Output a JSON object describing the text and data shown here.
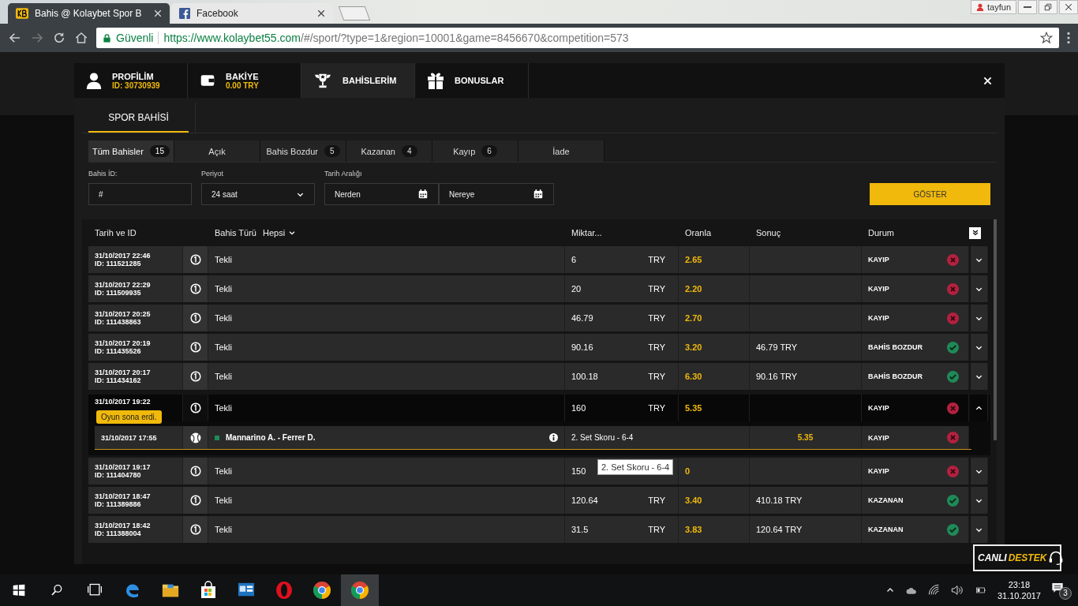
{
  "browser": {
    "tabs": [
      {
        "title": "Bahis @ Kolaybet Spor B",
        "selected": true
      },
      {
        "title": "Facebook",
        "selected": false
      }
    ],
    "user": "tayfun",
    "security": "Güvenli",
    "url_host": "https://www.kolaybet55.com",
    "url_path": "/#/sport/?type=1&region=10001&game=8456670&competition=573"
  },
  "modal": {
    "nav": [
      {
        "kind": "profile",
        "label": "PROFİLİM",
        "sub": "ID: 30730939",
        "selected": false
      },
      {
        "kind": "balance",
        "label": "BAKİYE",
        "sub": "0.00 TRY",
        "selected": false
      },
      {
        "kind": "bets",
        "label": "BAHİSLERİM",
        "selected": true
      },
      {
        "kind": "bonus",
        "label": "BONUSLAR",
        "selected": false
      }
    ],
    "section_tabs": [
      {
        "label": "SPOR BAHİSİ",
        "selected": true
      }
    ],
    "filter_tabs": [
      {
        "label": "Tüm Bahisler",
        "count": "15",
        "selected": true
      },
      {
        "label": "Açık",
        "selected": false
      },
      {
        "label": "Bahis Bozdur",
        "count": "5",
        "selected": false
      },
      {
        "label": "Kazanan",
        "count": "4",
        "selected": false
      },
      {
        "label": "Kayıp",
        "count": "6",
        "selected": false
      },
      {
        "label": "İade",
        "selected": false
      }
    ],
    "filters": {
      "bet_id": {
        "label": "Bahis İD:",
        "value": "#"
      },
      "period": {
        "label": "Periyot",
        "value": "24 saat"
      },
      "date_range": {
        "label": "Tarih Aralığı",
        "from": "Nerden",
        "to": "Nereye"
      },
      "show_button": "GÖSTER"
    },
    "table": {
      "columns": [
        "Tarih ve ID",
        "Bahis Türü",
        "Miktar...",
        "Oranla",
        "Sonuç",
        "Durum"
      ],
      "type_filter": "Hepsi",
      "rows": [
        {
          "date": "31/10/2017 22:46",
          "id": "ID: 111521285",
          "type": "Tekli",
          "amount": "6",
          "currency": "TRY",
          "odds": "2.65",
          "status": "KAYIP",
          "won": false,
          "expanded": false
        },
        {
          "date": "31/10/2017 22:29",
          "id": "ID: 111509935",
          "type": "Tekli",
          "amount": "20",
          "currency": "TRY",
          "odds": "2.20",
          "status": "KAYIP",
          "won": false,
          "expanded": false
        },
        {
          "date": "31/10/2017 20:25",
          "id": "ID: 111438863",
          "type": "Tekli",
          "amount": "46.79",
          "currency": "TRY",
          "odds": "2.70",
          "status": "KAYIP",
          "won": false,
          "expanded": false
        },
        {
          "date": "31/10/2017 20:19",
          "id": "ID: 111435526",
          "type": "Tekli",
          "amount": "90.16",
          "currency": "TRY",
          "odds": "3.20",
          "result": "46.79 TRY",
          "status": "BAHİS BOZDUR",
          "won": true,
          "expanded": false
        },
        {
          "date": "31/10/2017 20:17",
          "id": "ID: 111434162",
          "type": "Tekli",
          "amount": "100.18",
          "currency": "TRY",
          "odds": "6.30",
          "result": "90.16 TRY",
          "status": "BAHİS BOZDUR",
          "won": true,
          "expanded": false
        },
        {
          "date": "31/10/2017 19:22",
          "type": "Tekli",
          "amount": "160",
          "currency": "TRY",
          "odds": "5.35",
          "status": "KAYIP",
          "won": false,
          "expanded": true,
          "tooltip": "Oyun sona erdi.",
          "detail": {
            "time": "31/10/2017 17:55",
            "match": "Mannarino A. - Ferrer D.",
            "market": "2. Set Skoru - 6-4",
            "odds": "5.35",
            "status": "KAYIP",
            "won": false,
            "hover_tooltip": "2. Set Skoru - 6-4"
          }
        },
        {
          "date": "31/10/2017 19:17",
          "id": "ID: 111404780",
          "type": "Tekli",
          "amount": "150",
          "odds": "0",
          "status": "KAYIP",
          "won": false,
          "expanded": false
        },
        {
          "date": "31/10/2017 18:47",
          "id": "ID: 111389886",
          "type": "Tekli",
          "amount": "120.64",
          "currency": "TRY",
          "odds": "3.40",
          "result": "410.18 TRY",
          "status": "KAZANAN",
          "won": true,
          "expanded": false
        },
        {
          "date": "31/10/2017 18:42",
          "id": "ID: 111388004",
          "type": "Tekli",
          "amount": "31.5",
          "currency": "TRY",
          "odds": "3.83",
          "result": "120.64 TRY",
          "status": "KAZANAN",
          "won": true,
          "expanded": false
        }
      ]
    }
  },
  "live_support": {
    "part_1": "CANLI",
    "part_2": "DESTEK"
  },
  "taskbar": {
    "apps": [
      {
        "kind": "taskview",
        "selected": false
      },
      {
        "kind": "edge",
        "selected": false
      },
      {
        "kind": "explorer",
        "selected": false
      },
      {
        "kind": "store",
        "selected": false
      },
      {
        "kind": "window",
        "selected": false
      },
      {
        "kind": "opera",
        "selected": false
      },
      {
        "kind": "chrome",
        "selected": false
      },
      {
        "kind": "chrome",
        "selected": true
      }
    ],
    "time": "23:18",
    "date": "31.10.2017",
    "notifications": "3"
  }
}
